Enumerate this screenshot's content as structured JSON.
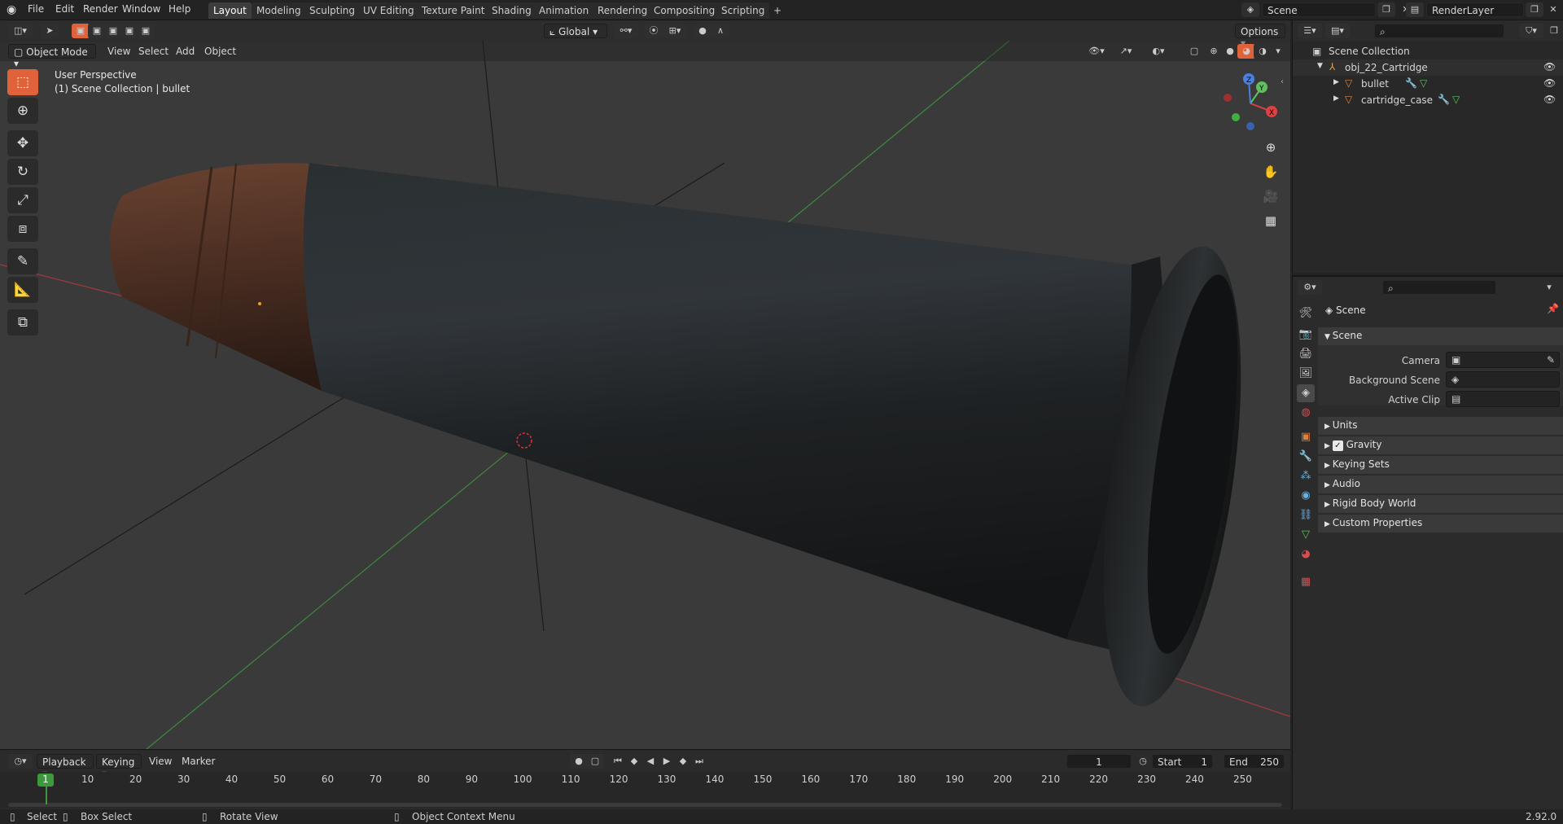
{
  "menubar": {
    "items": [
      "File",
      "Edit",
      "Render",
      "Window",
      "Help"
    ],
    "workspaces": [
      "Layout",
      "Modeling",
      "Sculpting",
      "UV Editing",
      "Texture Paint",
      "Shading",
      "Animation",
      "Rendering",
      "Compositing",
      "Scripting"
    ],
    "add_tab": "+",
    "scene": "Scene",
    "render_layer": "RenderLayer"
  },
  "viewport": {
    "mode": "Object Mode",
    "menu": [
      "View",
      "Select",
      "Add",
      "Object"
    ],
    "transform_orientation": "Global",
    "options": "Options",
    "overlay_line1": "User Perspective",
    "overlay_line2": "(1) Scene Collection | bullet",
    "gizmo_axes": [
      "X",
      "Y",
      "Z"
    ],
    "tools": [
      "select-box-icon",
      "cursor-icon",
      "move-icon",
      "rotate-icon",
      "scale-icon",
      "transform-icon",
      "annotate-icon",
      "measure-icon",
      "add-cube-icon"
    ]
  },
  "outliner": {
    "collection": "Scene Collection",
    "object": "obj_22_Cartridge",
    "children": [
      "bullet",
      "cartridge_case"
    ]
  },
  "properties": {
    "header": "Scene",
    "panel": "Scene",
    "camera_label": "Camera",
    "bgscene_label": "Background Scene",
    "activeclip_label": "Active Clip",
    "sections": [
      "Units",
      "Gravity",
      "Keying Sets",
      "Audio",
      "Rigid Body World",
      "Custom Properties"
    ],
    "gravity_checked": true
  },
  "timeline": {
    "menu": [
      "Playback",
      "Keying",
      "View",
      "Marker"
    ],
    "current_frame": "1",
    "start_label": "Start",
    "start": "1",
    "end_label": "End",
    "end": "250",
    "ticks": [
      "1",
      "10",
      "20",
      "30",
      "40",
      "50",
      "60",
      "70",
      "80",
      "90",
      "100",
      "110",
      "120",
      "130",
      "140",
      "150",
      "160",
      "170",
      "180",
      "190",
      "200",
      "210",
      "220",
      "230",
      "240",
      "250"
    ]
  },
  "statusbar": {
    "select": "Select",
    "box_select": "Box Select",
    "rotate_view": "Rotate View",
    "context_menu": "Object Context Menu",
    "version": "2.92.0"
  },
  "colors": {
    "accent": "#e0623a",
    "grid_x": "#a23a3a",
    "grid_y": "#3e8a3e",
    "header_bg": "#232323"
  }
}
